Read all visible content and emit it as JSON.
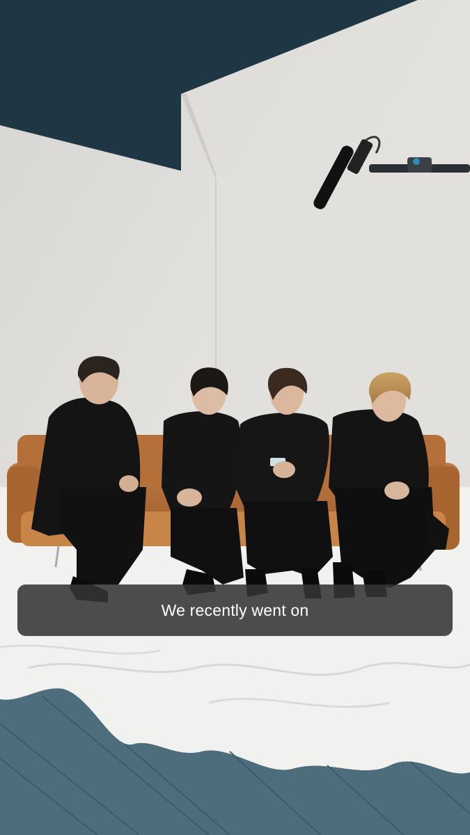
{
  "caption": {
    "text": "We recently went on"
  },
  "palette": {
    "ceiling": "#1f3645",
    "wall": "#dcdad7",
    "floor_cloth": "#f1f1f0",
    "floor_wood": "#4d6c7c",
    "sofa": "#b9733d",
    "suits": "#141414",
    "caption_bg": "#343434",
    "caption_text": "#ffffff"
  },
  "scene": {
    "people_count": 4,
    "icons": [
      "boom-microphone",
      "smartphone"
    ]
  }
}
